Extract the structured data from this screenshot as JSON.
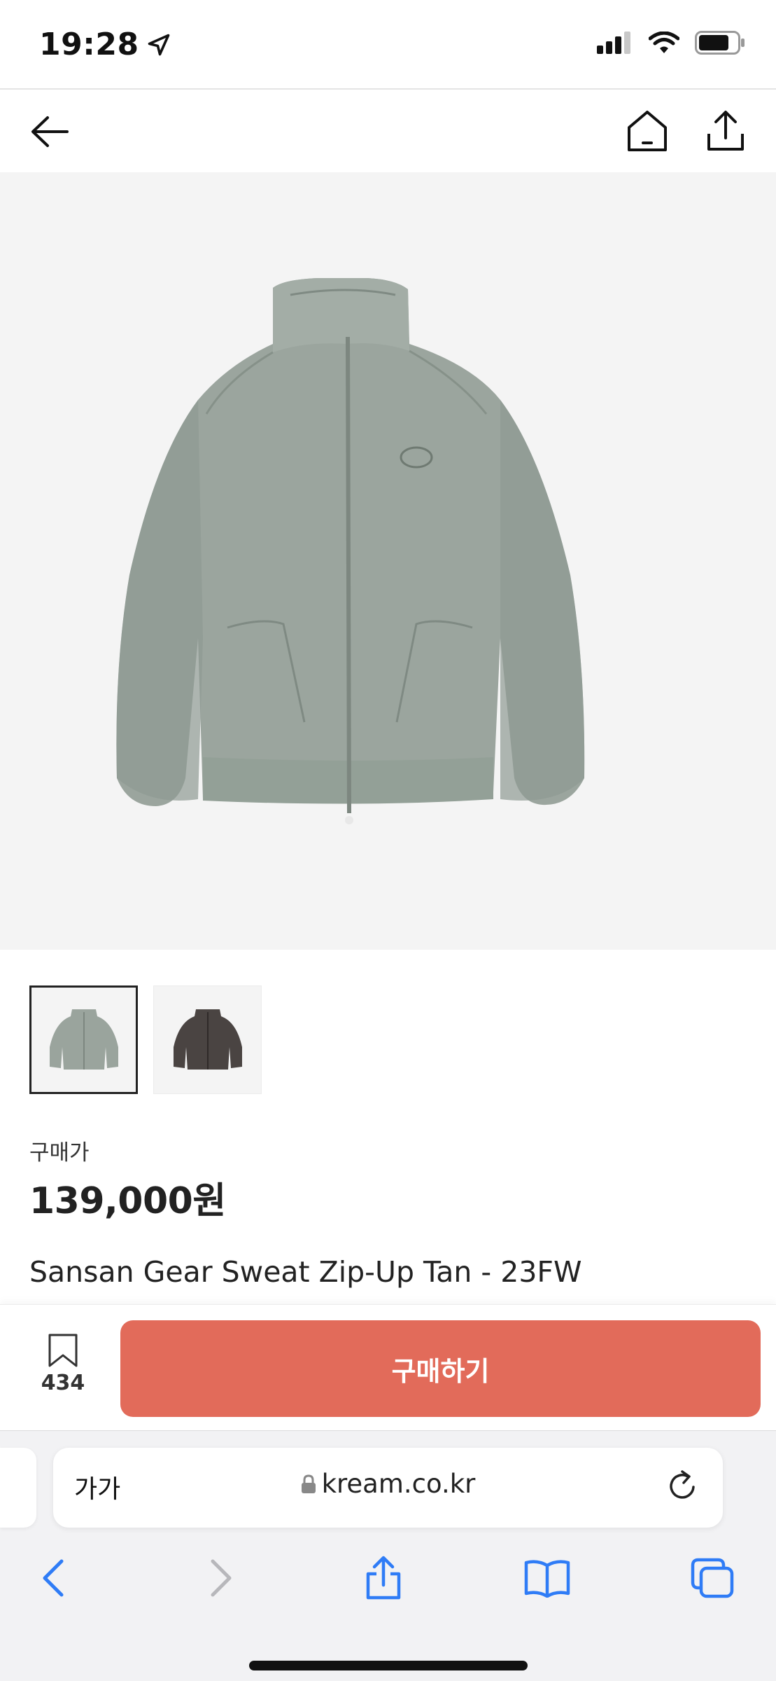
{
  "status": {
    "time": "19:28"
  },
  "nav": {
    "back_icon": "arrow-left-icon",
    "home_icon": "home-icon",
    "share_icon": "share-icon"
  },
  "product": {
    "image_icon": "zip-up-jacket-image",
    "thumbnails": [
      {
        "label": "sage-jacket-thumbnail",
        "color": "#9aa49d",
        "selected": true
      },
      {
        "label": "charcoal-jacket-thumbnail",
        "color": "#4a4442",
        "selected": false
      }
    ],
    "price_label": "구매가",
    "price": "139,000원",
    "name": "Sansan Gear Sweat Zip-Up Tan - 23FW"
  },
  "actions": {
    "wishlist_count": "434",
    "buy_label": "구매하기",
    "buy_color": "#e26b5a"
  },
  "browser": {
    "text_size_label": "가가",
    "url": "kream.co.kr"
  }
}
